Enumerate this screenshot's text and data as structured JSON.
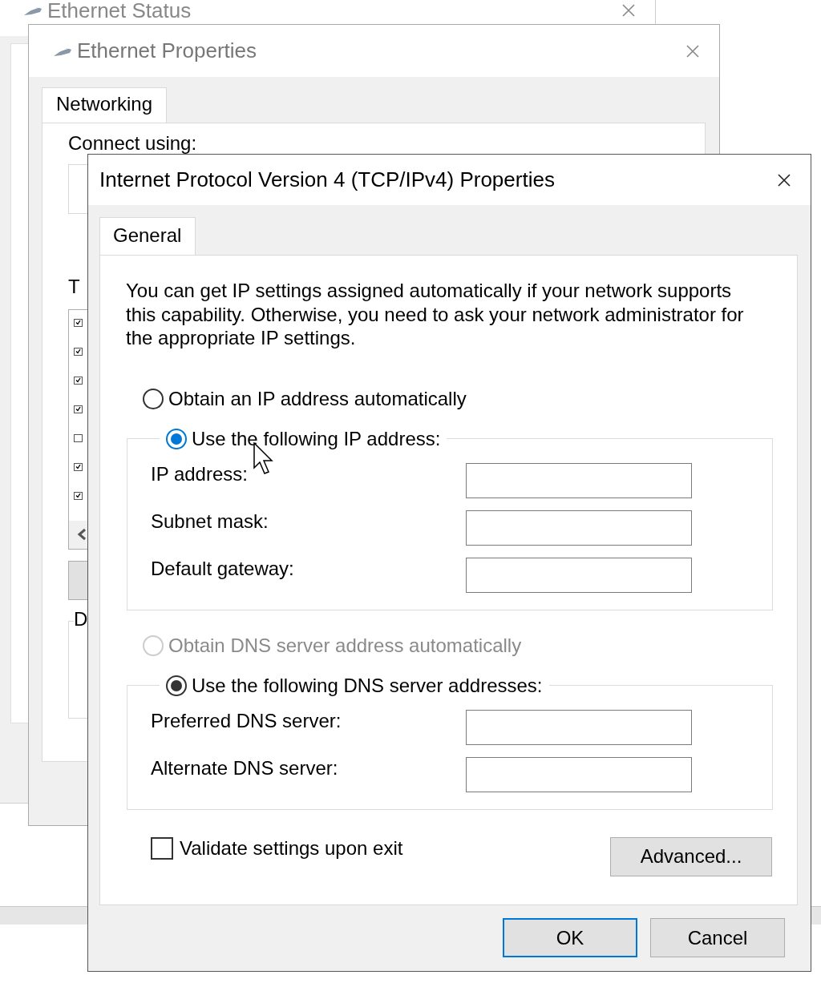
{
  "ethernet_status": {
    "title": "Ethernet Status"
  },
  "ethernet_properties": {
    "title": "Ethernet Properties",
    "tabs": [
      {
        "label": "Networking",
        "selected": true
      }
    ],
    "connect_label": "Connect using:",
    "items_label": "T",
    "items": [
      {
        "checked": true
      },
      {
        "checked": true
      },
      {
        "checked": true
      },
      {
        "checked": true
      },
      {
        "checked": false
      },
      {
        "checked": true
      },
      {
        "checked": true
      }
    ],
    "description_label": "D"
  },
  "ipv4_dialog": {
    "title": "Internet Protocol Version 4 (TCP/IPv4) Properties",
    "tabs": [
      {
        "label": "General",
        "selected": true
      }
    ],
    "intro": "You can get IP settings assigned automatically if your network supports this capability. Otherwise, you need to ask your network administrator for the appropriate IP settings.",
    "ip_options": [
      {
        "label": "Obtain an IP address automatically",
        "selected": false,
        "focused": false,
        "disabled": false
      },
      {
        "label": "Use the following IP address:",
        "selected": true,
        "focused": true,
        "disabled": false
      }
    ],
    "ip_fields": [
      {
        "label": "IP address:"
      },
      {
        "label": "Subnet mask:"
      },
      {
        "label": "Default gateway:"
      }
    ],
    "dns_options": [
      {
        "label": "Obtain DNS server address automatically",
        "selected": false,
        "focused": false,
        "disabled": true
      },
      {
        "label": "Use the following DNS server addresses:",
        "selected": true,
        "focused": false,
        "disabled": false
      }
    ],
    "dns_fields": [
      {
        "label": "Preferred DNS server:"
      },
      {
        "label": "Alternate DNS server:"
      }
    ],
    "validate": {
      "label": "Validate settings upon exit",
      "checked": false
    },
    "advanced_button": "Advanced...",
    "buttons": [
      {
        "label": "OK",
        "default": true
      },
      {
        "label": "Cancel",
        "default": false
      }
    ]
  }
}
